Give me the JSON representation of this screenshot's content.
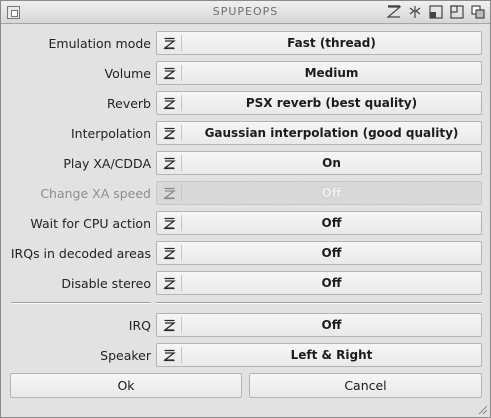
{
  "window": {
    "title": "SPUPEOPS"
  },
  "settings": [
    {
      "label": "Emulation mode",
      "value": "Fast (thread)"
    },
    {
      "label": "Volume",
      "value": "Medium"
    },
    {
      "label": "Reverb",
      "value": "PSX reverb (best quality)"
    },
    {
      "label": "Interpolation",
      "value": "Gaussian interpolation (good quality)"
    },
    {
      "label": "Play XA/CDDA",
      "value": "On"
    },
    {
      "label": "Change XA speed",
      "value": "Off",
      "disabled": true
    },
    {
      "label": "Wait for CPU action",
      "value": "Off"
    },
    {
      "label": "IRQs in decoded areas",
      "value": "Off"
    },
    {
      "label": "Disable stereo",
      "value": "Off"
    },
    {
      "label": "IRQ",
      "value": "Off"
    },
    {
      "label": "Speaker",
      "value": "Left & Right"
    }
  ],
  "buttons": {
    "ok": "Ok",
    "cancel": "Cancel"
  },
  "icons": {
    "close": "close-icon",
    "titlebar": [
      "snapshot-icon",
      "iconify-icon",
      "jump-icon",
      "zoom-icon",
      "depth-icon"
    ],
    "cycle": "cycle-icon",
    "resize": "resize-icon"
  },
  "colors": {
    "background": "#e2e2e2",
    "button": "#f0f0f0",
    "border": "#b4b4b4"
  }
}
